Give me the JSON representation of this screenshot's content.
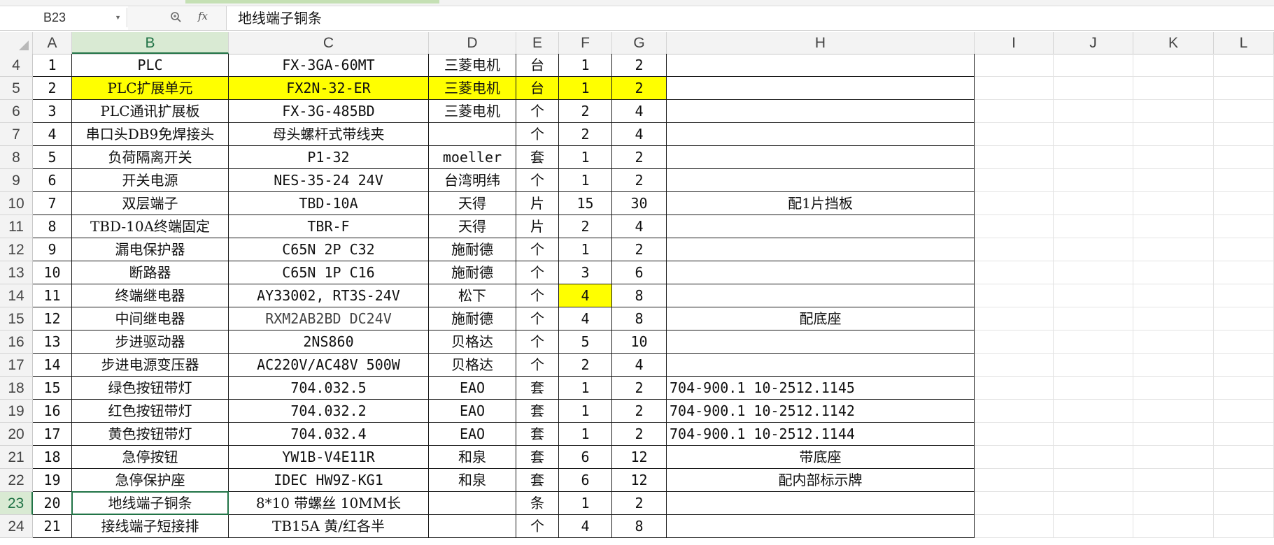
{
  "formula_bar": {
    "name_box": "B23",
    "content": "地线端子铜条",
    "zoom_icon": "zoom-icon",
    "fx_label": "fx"
  },
  "columns": [
    "A",
    "B",
    "C",
    "D",
    "E",
    "F",
    "G",
    "H",
    "I",
    "J",
    "K",
    "L"
  ],
  "selected_column": "B",
  "colors": {
    "highlight": "#ffff00",
    "selection": "#217346"
  },
  "rows": [
    {
      "row": "4",
      "A": "1",
      "B": "PLC",
      "C": "FX-3GA-60MT",
      "D": "三菱电机",
      "E": "台",
      "F": "1",
      "G": "2",
      "H": ""
    },
    {
      "row": "5",
      "A": "2",
      "B": "PLC扩展单元",
      "C": "FX2N-32-ER",
      "D": "三菱电机",
      "E": "台",
      "F": "1",
      "G": "2",
      "H": ""
    },
    {
      "row": "6",
      "A": "3",
      "B": "PLC通讯扩展板",
      "C": "FX-3G-485BD",
      "D": "三菱电机",
      "E": "个",
      "F": "2",
      "G": "4",
      "H": ""
    },
    {
      "row": "7",
      "A": "4",
      "B": "串口头DB9免焊接头",
      "C": "母头螺杆式带线夹",
      "D": "",
      "E": "个",
      "F": "2",
      "G": "4",
      "H": ""
    },
    {
      "row": "8",
      "A": "5",
      "B": "负荷隔离开关",
      "C": "P1-32",
      "D": "moeller",
      "E": "套",
      "F": "1",
      "G": "2",
      "H": ""
    },
    {
      "row": "9",
      "A": "6",
      "B": "开关电源",
      "C": "NES-35-24 24V",
      "D": "台湾明纬",
      "E": "个",
      "F": "1",
      "G": "2",
      "H": ""
    },
    {
      "row": "10",
      "A": "7",
      "B": "双层端子",
      "C": "TBD-10A",
      "D": "天得",
      "E": "片",
      "F": "15",
      "G": "30",
      "H": "配1片挡板"
    },
    {
      "row": "11",
      "A": "8",
      "B": "TBD-10A终端固定",
      "C": "TBR-F",
      "D": "天得",
      "E": "片",
      "F": "2",
      "G": "4",
      "H": ""
    },
    {
      "row": "12",
      "A": "9",
      "B": "漏电保护器",
      "C": "C65N 2P C32",
      "D": "施耐德",
      "E": "个",
      "F": "1",
      "G": "2",
      "H": ""
    },
    {
      "row": "13",
      "A": "10",
      "B": "断路器",
      "C": "C65N 1P C16",
      "D": "施耐德",
      "E": "个",
      "F": "3",
      "G": "6",
      "H": ""
    },
    {
      "row": "14",
      "A": "11",
      "B": "终端继电器",
      "C": "AY33002, RT3S-24V",
      "D": "松下",
      "E": "个",
      "F": "4",
      "G": "8",
      "H": ""
    },
    {
      "row": "15",
      "A": "12",
      "B": "中间继电器",
      "C": "RXM2AB2BD DC24V",
      "D": "施耐德",
      "E": "个",
      "F": "4",
      "G": "8",
      "H": "配底座"
    },
    {
      "row": "16",
      "A": "13",
      "B": "步进驱动器",
      "C": "2NS860",
      "D": "贝格达",
      "E": "个",
      "F": "5",
      "G": "10",
      "H": ""
    },
    {
      "row": "17",
      "A": "14",
      "B": "步进电源变压器",
      "C": "AC220V/AC48V 500W",
      "D": "贝格达",
      "E": "个",
      "F": "2",
      "G": "4",
      "H": ""
    },
    {
      "row": "18",
      "A": "15",
      "B": "绿色按钮带灯",
      "C": "704.032.5",
      "D": "EAO",
      "E": "套",
      "F": "1",
      "G": "2",
      "H": "704-900.1 10-2512.1145"
    },
    {
      "row": "19",
      "A": "16",
      "B": "红色按钮带灯",
      "C": "704.032.2",
      "D": "EAO",
      "E": "套",
      "F": "1",
      "G": "2",
      "H": "704-900.1 10-2512.1142"
    },
    {
      "row": "20",
      "A": "17",
      "B": "黄色按钮带灯",
      "C": "704.032.4",
      "D": "EAO",
      "E": "套",
      "F": "1",
      "G": "2",
      "H": "704-900.1 10-2512.1144"
    },
    {
      "row": "21",
      "A": "18",
      "B": "急停按钮",
      "C": "YW1B-V4E11R",
      "D": "和泉",
      "E": "套",
      "F": "6",
      "G": "12",
      "H": "带底座"
    },
    {
      "row": "22",
      "A": "19",
      "B": "急停保护座",
      "C": "IDEC  HW9Z-KG1",
      "D": "和泉",
      "E": "套",
      "F": "6",
      "G": "12",
      "H": "配内部标示牌"
    },
    {
      "row": "23",
      "A": "20",
      "B": "地线端子铜条",
      "C": "8*10 带螺丝 10MM长",
      "D": "",
      "E": "条",
      "F": "1",
      "G": "2",
      "H": ""
    },
    {
      "row": "24",
      "A": "21",
      "B": "接线端子短接排",
      "C": "TB15A 黄/红各半",
      "D": "",
      "E": "个",
      "F": "4",
      "G": "8",
      "H": ""
    }
  ]
}
